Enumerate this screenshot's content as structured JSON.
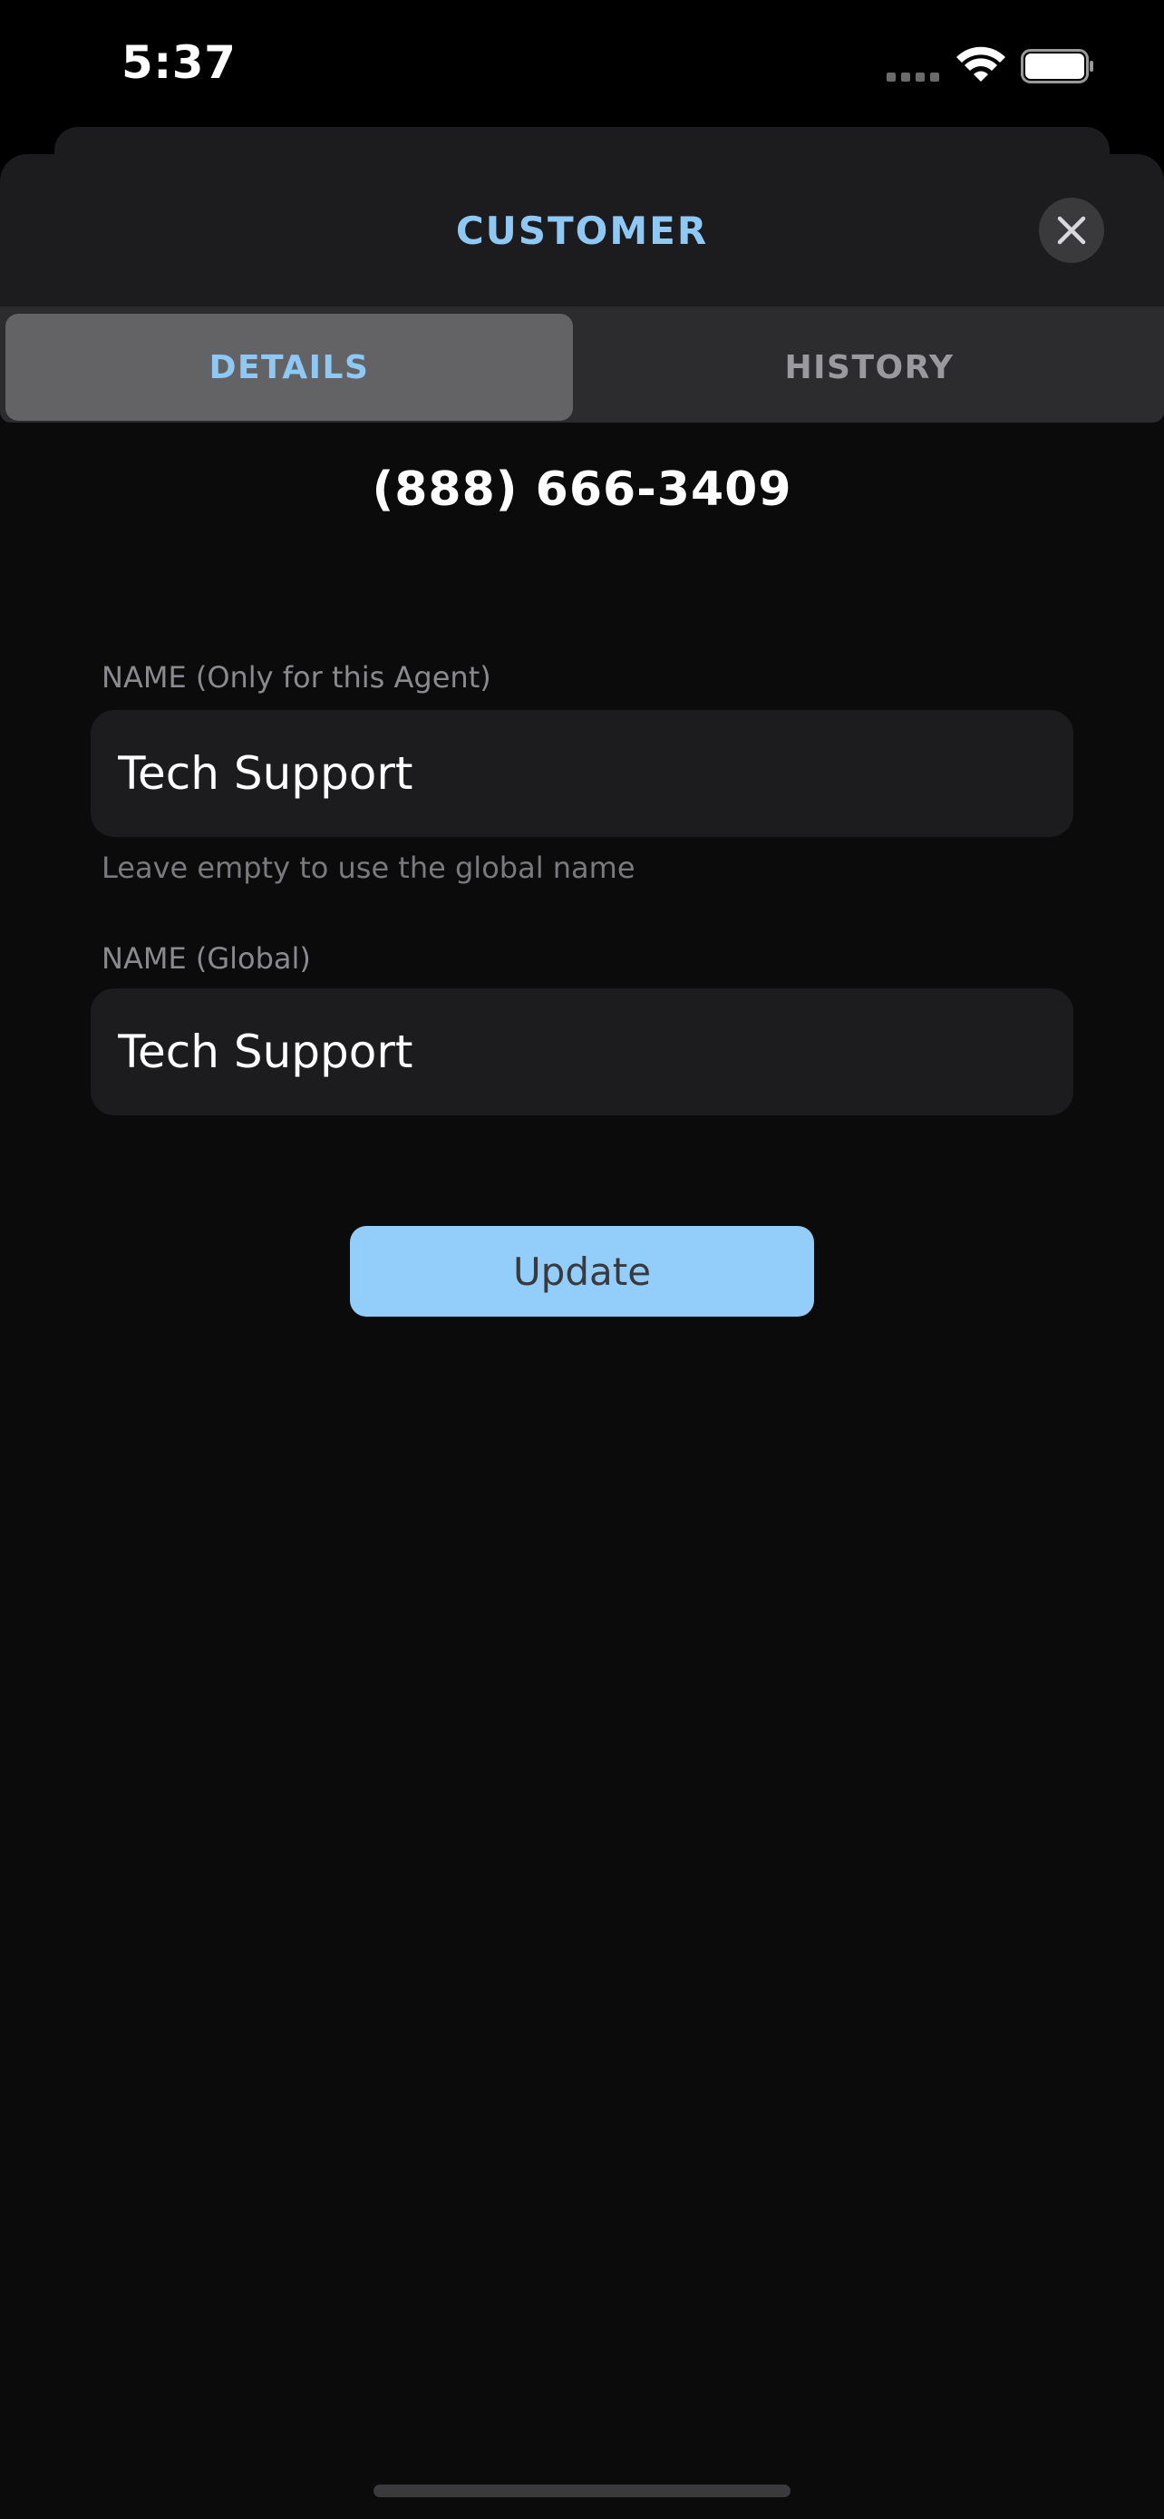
{
  "status_bar": {
    "time": "5:37",
    "signal_icon": "cellular-signal-icon",
    "wifi_icon": "wifi-icon",
    "battery_icon": "battery-icon"
  },
  "header": {
    "title": "CUSTOMER",
    "close_icon": "close-icon"
  },
  "tabs": [
    {
      "label": "DETAILS",
      "selected": true
    },
    {
      "label": "HISTORY",
      "selected": false
    }
  ],
  "customer": {
    "phone": "(888) 666-3409"
  },
  "fields": {
    "agent_name": {
      "label": "NAME (Only for this Agent)",
      "value": "Tech Support",
      "hint": "Leave empty to use the global name"
    },
    "global_name": {
      "label": "NAME (Global)",
      "value": "Tech Support"
    }
  },
  "actions": {
    "update_label": "Update"
  },
  "colors": {
    "accent": "#8ec8f5",
    "button": "#93cdf9",
    "background": "#0b0b0b",
    "surface": "#1c1c1e"
  }
}
